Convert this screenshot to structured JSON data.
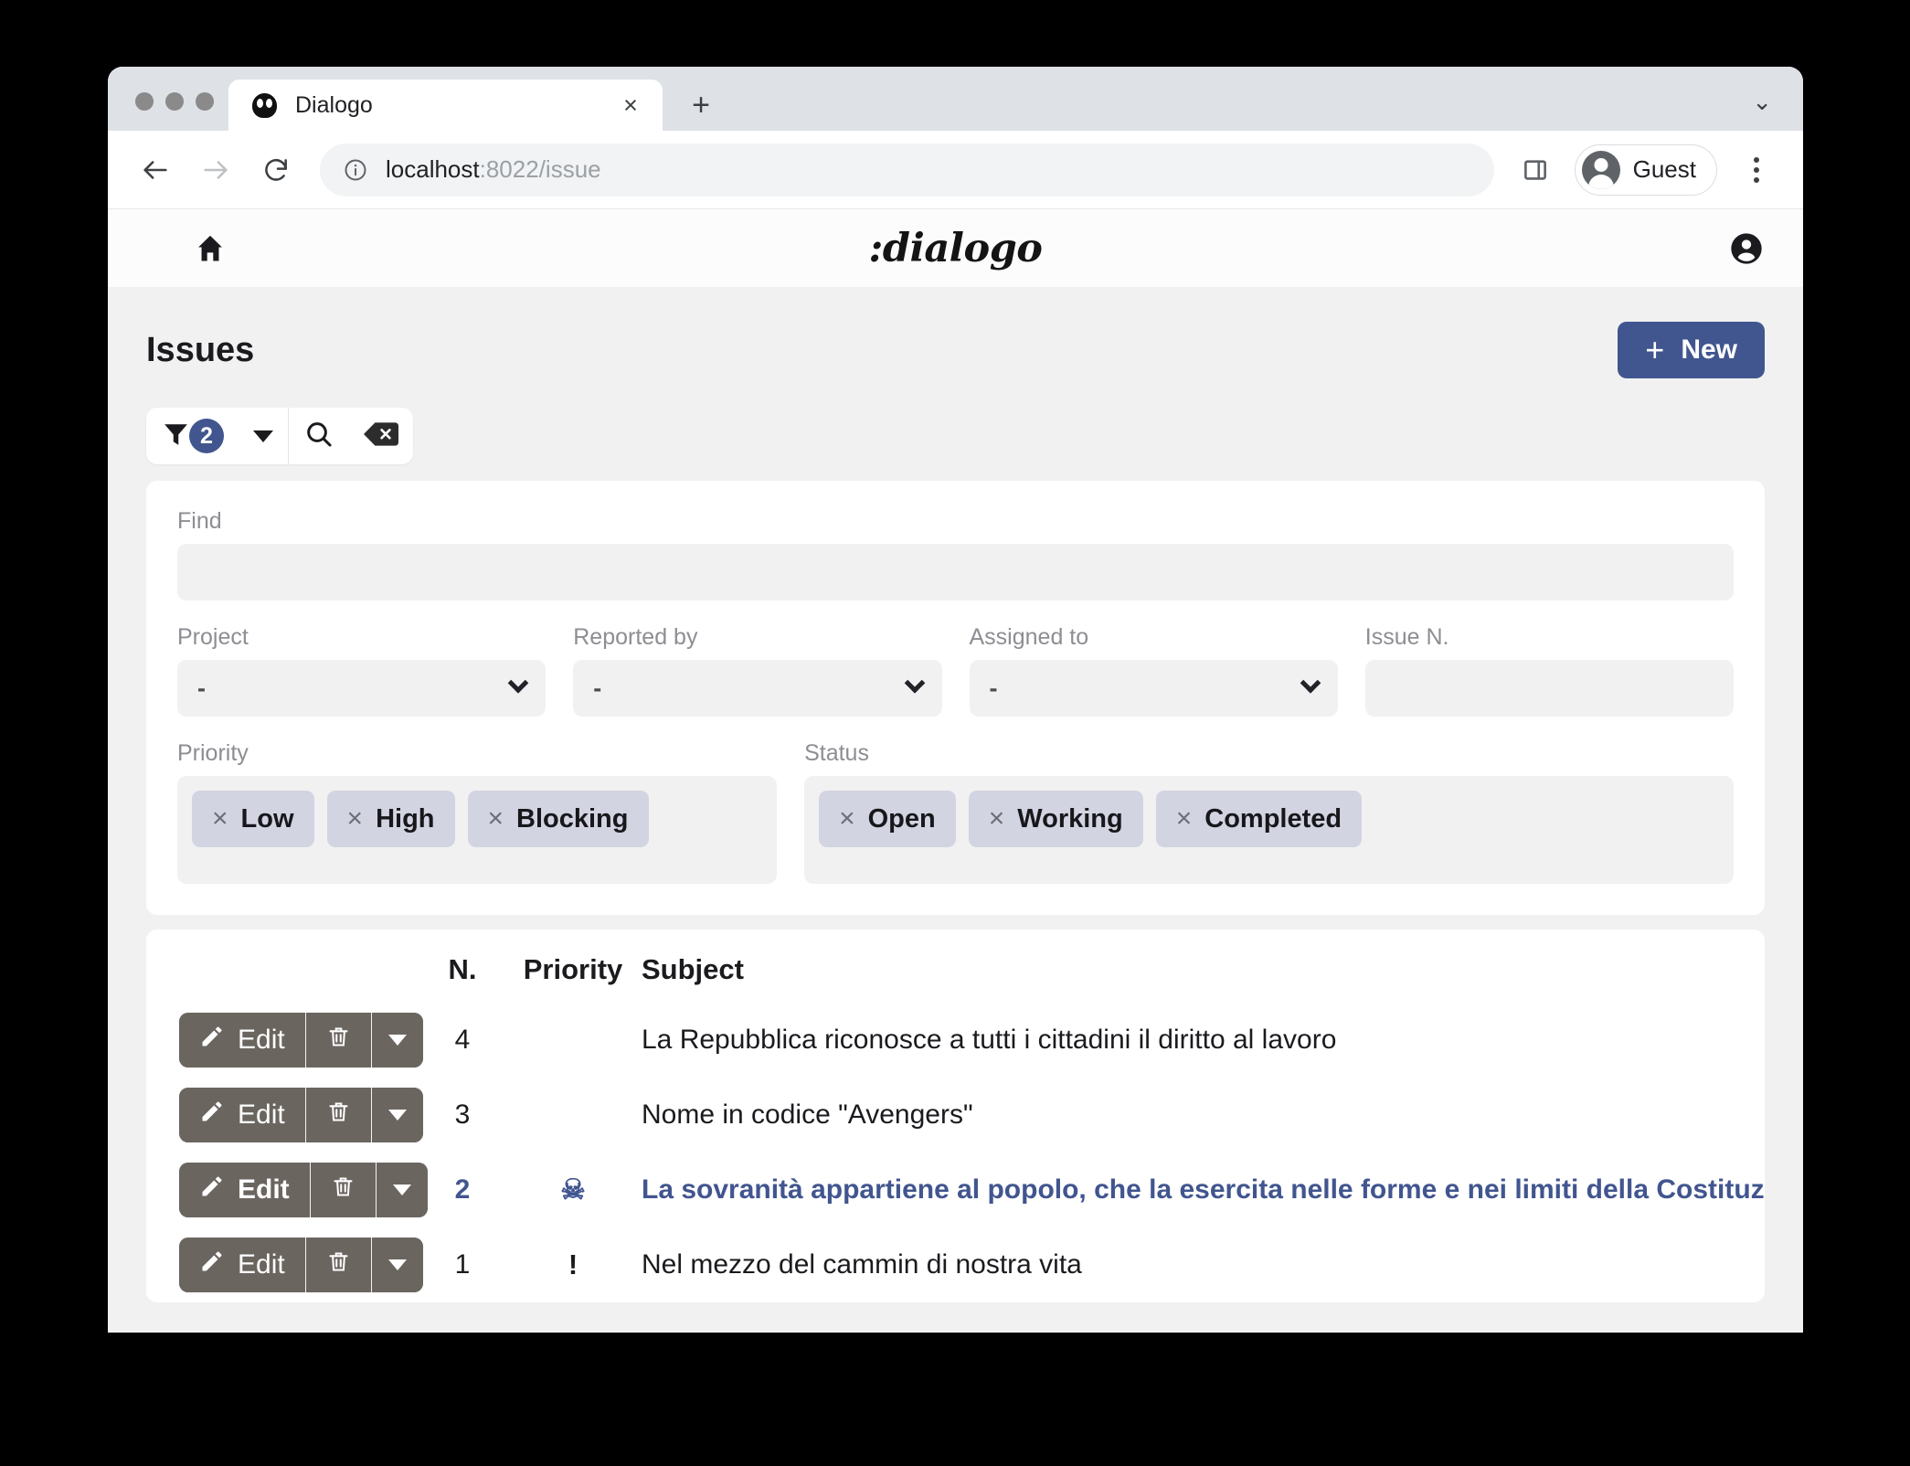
{
  "browser": {
    "tab": {
      "title": "Dialogo",
      "favicon": "dialogo-favicon",
      "close": "×"
    },
    "new_tab": "+",
    "tabstrip_menu": "⌄",
    "nav": {
      "back": "←",
      "forward": "→",
      "reload": "↻"
    },
    "omnibox": {
      "info_icon": "ⓘ",
      "url_host": "localhost",
      "url_rest": ":8022/issue",
      "full_url": "localhost:8022/issue"
    },
    "side_panel": "side-panel-icon",
    "profile": {
      "name": "Guest"
    },
    "menu": "kebab-menu"
  },
  "app_header": {
    "menu_icon": "hamburger-icon",
    "home_icon": "home-icon",
    "brand": ":dialogo",
    "account_icon": "account-icon"
  },
  "page": {
    "title": "Issues",
    "new_button": {
      "plus": "+",
      "label": "New"
    }
  },
  "filter_toolbar": {
    "filter_icon": "funnel-icon",
    "filter_count": "2",
    "dropdown_icon": "caret-down-icon",
    "search_icon": "search-icon",
    "clear_icon": "backspace-clear-icon"
  },
  "filter_panel": {
    "find": {
      "label": "Find",
      "value": "",
      "placeholder": ""
    },
    "project": {
      "label": "Project",
      "value": "-"
    },
    "reported_by": {
      "label": "Reported by",
      "value": "-"
    },
    "assigned_to": {
      "label": "Assigned to",
      "value": "-"
    },
    "issue_n": {
      "label": "Issue N.",
      "value": "",
      "placeholder": ""
    },
    "priority": {
      "label": "Priority",
      "chips": [
        {
          "x": "×",
          "label": "Low"
        },
        {
          "x": "×",
          "label": "High"
        },
        {
          "x": "×",
          "label": "Blocking"
        }
      ]
    },
    "status": {
      "label": "Status",
      "chips": [
        {
          "x": "×",
          "label": "Open"
        },
        {
          "x": "×",
          "label": "Working"
        },
        {
          "x": "×",
          "label": "Completed"
        }
      ]
    }
  },
  "table": {
    "headers": {
      "actions": "",
      "n": "N.",
      "priority": "Priority",
      "subject": "Subject"
    },
    "row_actions": {
      "edit_label": "Edit",
      "edit_icon": "pencil-icon",
      "delete_icon": "trash-icon",
      "more_icon": "caret-down-icon"
    },
    "rows": [
      {
        "n": "4",
        "priority_glyph": "",
        "priority_name": "none",
        "subject": "La Repubblica riconosce a tutti i cittadini il diritto al lavoro",
        "highlight": false
      },
      {
        "n": "3",
        "priority_glyph": "",
        "priority_name": "none",
        "subject": "Nome in codice \"Avengers\"",
        "highlight": false
      },
      {
        "n": "2",
        "priority_glyph": "☠",
        "priority_name": "blocking",
        "subject": "La sovranità appartiene al popolo, che la esercita nelle forme e nei limiti della Costituzione",
        "highlight": true
      },
      {
        "n": "1",
        "priority_glyph": "!",
        "priority_name": "high",
        "subject": "Nel mezzo del cammin di nostra vita",
        "highlight": false
      }
    ]
  },
  "colors": {
    "accent_blue": "#41558f",
    "chip_bg": "#d3d4e1",
    "button_gray": "#6b6560",
    "page_bg": "#f1f1f2"
  }
}
